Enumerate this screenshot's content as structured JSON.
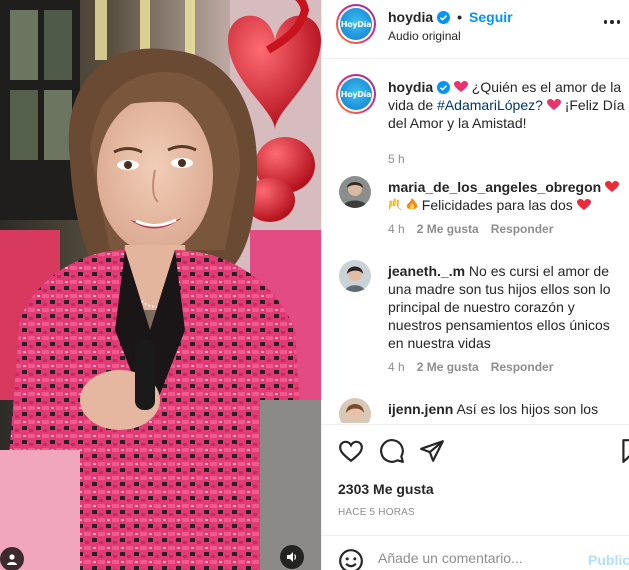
{
  "post": {
    "username": "hoydia",
    "follow_label": "Seguir",
    "audio_label": "Audio original",
    "logo_text": "HoyDía"
  },
  "caption": {
    "username": "hoydia",
    "text_before": "¿Quién es el amor de la vida de",
    "hashtag": "#AdamariLópez?",
    "text_after": "¡Feliz Día del Amor y la Amistad!",
    "time": "5 h"
  },
  "comments": [
    {
      "username": "maria_de_los_angeles_obregon",
      "text_tail": "Felicidades para las dos",
      "time": "4 h",
      "likes": "2 Me gusta",
      "reply": "Responder"
    },
    {
      "username": "jeaneth._.m",
      "text": "No es cursi el amor de una madre son tus hijos ellos son lo principal de nuestro corazón y nuestros pensamientos ellos únicos en nuestra vidas",
      "time": "4 h",
      "likes": "2 Me gusta",
      "reply": "Responder"
    },
    {
      "username": "ijenn.jenn",
      "text": "Así es los hijos son los"
    }
  ],
  "actions": {
    "likes_count": "2303 Me gusta",
    "time_ago": "HACE 5 HORAS"
  },
  "add_comment": {
    "placeholder": "Añade un comentario...",
    "post_label": "Publicar"
  },
  "icons": {
    "like": "heart-icon",
    "comment": "comment-icon",
    "share": "share-icon",
    "save": "bookmark-icon",
    "emoji": "emoji-icon",
    "audio": "speaker-icon",
    "user_tag": "user-icon"
  },
  "colors": {
    "accent": "#0095f6",
    "hashtag": "#00376b",
    "heart_red": "#ed4956",
    "jacket_pink": "#e8336f"
  }
}
